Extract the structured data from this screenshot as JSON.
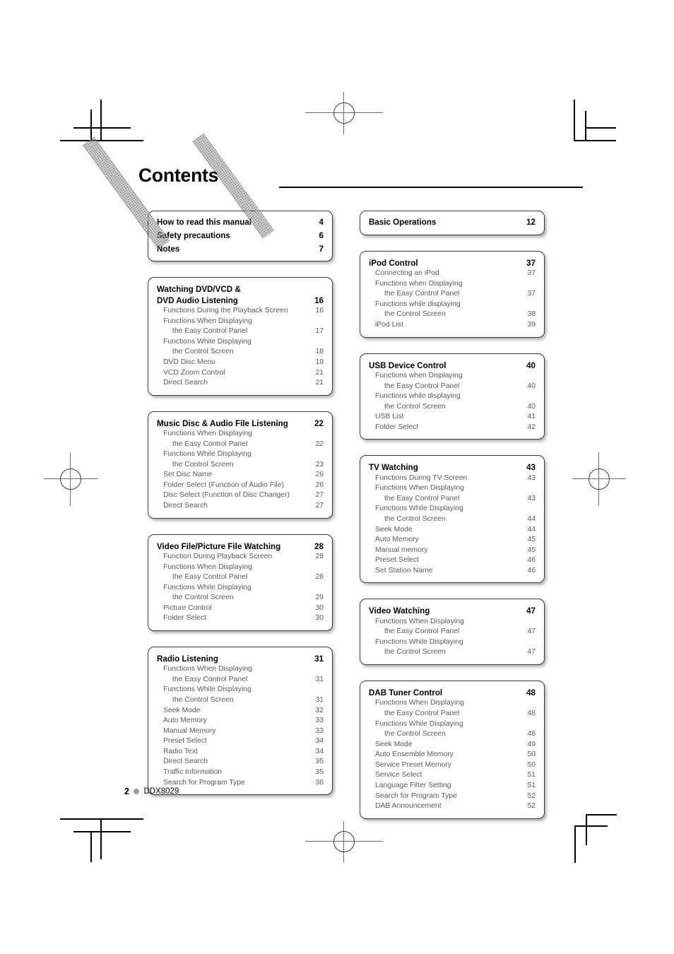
{
  "header": {
    "title": "Contents"
  },
  "footer": {
    "page_number": "2",
    "bullet_icon": "dot-icon",
    "model": "DDX8029"
  },
  "colors": {
    "box_border": "#3b3b3b",
    "heading_text": "#000000",
    "sub_text": "#5a5a5a",
    "footer_dot": "#9a9a9a",
    "rule": "#000000"
  },
  "columns": {
    "left": [
      {
        "id": "quick-links",
        "type": "bold-list",
        "entries": [
          {
            "label": "How to read this manual",
            "page": "4"
          },
          {
            "label": "Safety precautions",
            "page": "6"
          },
          {
            "label": "Notes",
            "page": "7"
          }
        ]
      },
      {
        "id": "watching-dvd-vcd",
        "type": "chapter",
        "heading_lines": [
          "Watching DVD/VCD &",
          "DVD Audio Listening"
        ],
        "heading_page": "16",
        "entries": [
          {
            "lines": [
              "Functions During the Playback Screen"
            ],
            "page": "16"
          },
          {
            "lines": [
              "Functions When Displaying",
              "the Easy Control Panel"
            ],
            "page": "17"
          },
          {
            "lines": [
              "Functions While Displaying",
              "the Control Screen"
            ],
            "page": "18"
          },
          {
            "lines": [
              "DVD Disc Menu"
            ],
            "page": "19"
          },
          {
            "lines": [
              "VCD Zoom Control"
            ],
            "page": "21"
          },
          {
            "lines": [
              "Direct Search"
            ],
            "page": "21"
          }
        ]
      },
      {
        "id": "music-disc-audio-file",
        "type": "chapter",
        "heading_lines": [
          "Music Disc & Audio File Listening"
        ],
        "heading_page": "22",
        "entries": [
          {
            "lines": [
              "Functions When Displaying",
              "the Easy Control Panel"
            ],
            "page": "22"
          },
          {
            "lines": [
              "Functions While Displaying",
              "the Control Screen"
            ],
            "page": "23"
          },
          {
            "lines": [
              "Set Disc Name"
            ],
            "page": "26"
          },
          {
            "lines": [
              "Folder Select (Function of Audio File)"
            ],
            "page": "26"
          },
          {
            "lines": [
              "Disc Select (Function of Disc Changer)"
            ],
            "page": "27"
          },
          {
            "lines": [
              "Direct Search"
            ],
            "page": "27"
          }
        ]
      },
      {
        "id": "video-picture-file",
        "type": "chapter",
        "heading_lines": [
          "Video File/Picture File Watching"
        ],
        "heading_page": "28",
        "entries": [
          {
            "lines": [
              "Function During Playback Screen"
            ],
            "page": "28"
          },
          {
            "lines": [
              "Functions When Displaying",
              "the Easy Control Panel"
            ],
            "page": "28"
          },
          {
            "lines": [
              "Functions While Displaying",
              "the Control Screen"
            ],
            "page": "29"
          },
          {
            "lines": [
              "Picture Control"
            ],
            "page": "30"
          },
          {
            "lines": [
              "Folder Select"
            ],
            "page": "30"
          }
        ]
      },
      {
        "id": "radio-listening",
        "type": "chapter",
        "heading_lines": [
          "Radio Listening"
        ],
        "heading_page": "31",
        "entries": [
          {
            "lines": [
              "Functions When Displaying",
              "the Easy Control Panel"
            ],
            "page": "31"
          },
          {
            "lines": [
              "Functions While Displaying",
              "the Control Screen"
            ],
            "page": "31"
          },
          {
            "lines": [
              "Seek Mode"
            ],
            "page": "32"
          },
          {
            "lines": [
              "Auto Memory"
            ],
            "page": "33"
          },
          {
            "lines": [
              "Manual Memory"
            ],
            "page": "33"
          },
          {
            "lines": [
              "Preset Select"
            ],
            "page": "34"
          },
          {
            "lines": [
              "Radio Text"
            ],
            "page": "34"
          },
          {
            "lines": [
              "Direct Search"
            ],
            "page": "35"
          },
          {
            "lines": [
              "Traffic Information"
            ],
            "page": "35"
          },
          {
            "lines": [
              "Search for Program Type"
            ],
            "page": "36"
          }
        ]
      }
    ],
    "right": [
      {
        "id": "basic-operations",
        "type": "bold-list",
        "entries": [
          {
            "label": "Basic Operations",
            "page": "12"
          }
        ]
      },
      {
        "id": "ipod-control",
        "type": "chapter",
        "heading_lines": [
          "iPod Control"
        ],
        "heading_page": "37",
        "entries": [
          {
            "lines": [
              "Connecting an iPod"
            ],
            "page": "37"
          },
          {
            "lines": [
              "Functions when Displaying",
              "the Easy Control Panel"
            ],
            "page": "37"
          },
          {
            "lines": [
              "Functions while displaying",
              "the Control Screen"
            ],
            "page": "38"
          },
          {
            "lines": [
              "iPod List"
            ],
            "page": "39"
          }
        ]
      },
      {
        "id": "usb-device-control",
        "type": "chapter",
        "heading_lines": [
          "USB Device Control"
        ],
        "heading_page": "40",
        "entries": [
          {
            "lines": [
              "Functions when Displaying",
              "the Easy Control Panel"
            ],
            "page": "40"
          },
          {
            "lines": [
              "Functions while displaying",
              "the Control Screen"
            ],
            "page": "40"
          },
          {
            "lines": [
              "USB List"
            ],
            "page": "41"
          },
          {
            "lines": [
              "Folder Select"
            ],
            "page": "42"
          }
        ]
      },
      {
        "id": "tv-watching",
        "type": "chapter",
        "heading_lines": [
          "TV Watching"
        ],
        "heading_page": "43",
        "entries": [
          {
            "lines": [
              "Functions During TV Screen"
            ],
            "page": "43"
          },
          {
            "lines": [
              "Functions When Displaying",
              "the Easy Control Panel"
            ],
            "page": "43"
          },
          {
            "lines": [
              "Functions While Displaying",
              "the Control Screen"
            ],
            "page": "44"
          },
          {
            "lines": [
              "Seek Mode"
            ],
            "page": "44"
          },
          {
            "lines": [
              "Auto Memory"
            ],
            "page": "45"
          },
          {
            "lines": [
              "Manual memory"
            ],
            "page": "45"
          },
          {
            "lines": [
              "Preset Select"
            ],
            "page": "46"
          },
          {
            "lines": [
              "Set Station Name"
            ],
            "page": "46"
          }
        ]
      },
      {
        "id": "video-watching",
        "type": "chapter",
        "heading_lines": [
          "Video Watching"
        ],
        "heading_page": "47",
        "entries": [
          {
            "lines": [
              "Functions When Displaying",
              "the Easy Control Panel"
            ],
            "page": "47"
          },
          {
            "lines": [
              "Functions While Displaying",
              "the Control Screen"
            ],
            "page": "47"
          }
        ]
      },
      {
        "id": "dab-tuner-control",
        "type": "chapter",
        "heading_lines": [
          "DAB Tuner Control"
        ],
        "heading_page": "48",
        "entries": [
          {
            "lines": [
              "Functions When Displaying",
              "the Easy Control Panel"
            ],
            "page": "48"
          },
          {
            "lines": [
              "Functions While Displaying",
              "the Control Screen"
            ],
            "page": "48"
          },
          {
            "lines": [
              "Seek Mode"
            ],
            "page": "49"
          },
          {
            "lines": [
              "Auto Ensemble Memory"
            ],
            "page": "50"
          },
          {
            "lines": [
              "Service Preset Memory"
            ],
            "page": "50"
          },
          {
            "lines": [
              "Service Select"
            ],
            "page": "51"
          },
          {
            "lines": [
              "Language Filter Setting"
            ],
            "page": "51"
          },
          {
            "lines": [
              "Search for Program Type"
            ],
            "page": "52"
          },
          {
            "lines": [
              "DAB Announcement"
            ],
            "page": "52"
          }
        ]
      }
    ]
  }
}
